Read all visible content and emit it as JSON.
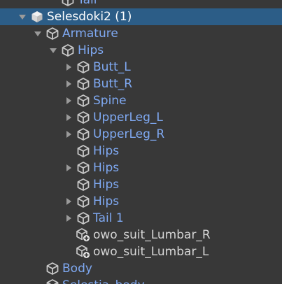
{
  "hierarchy": {
    "rows": [
      {
        "label": "Tail",
        "depth": 2,
        "fold": "none",
        "icon": "prefab-cube-icon",
        "color": "blue"
      },
      {
        "label": "Selesdoki2 (1)",
        "depth": 0,
        "fold": "expanded",
        "icon": "prefab-root-icon",
        "color": "white",
        "selected": true
      },
      {
        "label": "Armature",
        "depth": 1,
        "fold": "expanded",
        "icon": "prefab-cube-icon",
        "color": "blue"
      },
      {
        "label": "Hips",
        "depth": 2,
        "fold": "expanded",
        "icon": "prefab-cube-icon",
        "color": "blue"
      },
      {
        "label": "Butt_L",
        "depth": 3,
        "fold": "collapsed",
        "icon": "prefab-cube-icon",
        "color": "blue"
      },
      {
        "label": "Butt_R",
        "depth": 3,
        "fold": "collapsed",
        "icon": "prefab-cube-icon",
        "color": "blue"
      },
      {
        "label": "Spine",
        "depth": 3,
        "fold": "collapsed",
        "icon": "prefab-cube-icon",
        "color": "blue"
      },
      {
        "label": "UpperLeg_L",
        "depth": 3,
        "fold": "collapsed",
        "icon": "prefab-cube-icon",
        "color": "blue"
      },
      {
        "label": "UpperLeg_R",
        "depth": 3,
        "fold": "collapsed",
        "icon": "prefab-cube-icon",
        "color": "blue"
      },
      {
        "label": "Hips",
        "depth": 3,
        "fold": "none",
        "icon": "prefab-cube-icon",
        "color": "blue"
      },
      {
        "label": "Hips",
        "depth": 3,
        "fold": "collapsed",
        "icon": "prefab-cube-icon",
        "color": "blue"
      },
      {
        "label": "Hips",
        "depth": 3,
        "fold": "none",
        "icon": "prefab-cube-icon",
        "color": "blue"
      },
      {
        "label": "Hips",
        "depth": 3,
        "fold": "collapsed",
        "icon": "prefab-cube-icon",
        "color": "blue"
      },
      {
        "label": "Tail 1",
        "depth": 3,
        "fold": "collapsed",
        "icon": "prefab-cube-icon",
        "color": "blue"
      },
      {
        "label": "owo_suit_Lumbar_R",
        "depth": 3,
        "fold": "none",
        "icon": "gameobject-added-icon",
        "color": "white"
      },
      {
        "label": "owo_suit_Lumbar_L",
        "depth": 3,
        "fold": "none",
        "icon": "gameobject-added-icon",
        "color": "white"
      },
      {
        "label": "Body",
        "depth": 1,
        "fold": "none",
        "icon": "prefab-cube-icon",
        "color": "blue"
      },
      {
        "label": "Selestia_body",
        "depth": 1,
        "fold": "none",
        "icon": "prefab-cube-icon",
        "color": "blue"
      }
    ]
  },
  "colors": {
    "background": "#383838",
    "selection": "#2c5d87",
    "prefab_text": "#7fa9f2",
    "normal_text": "#d6d6d6"
  }
}
